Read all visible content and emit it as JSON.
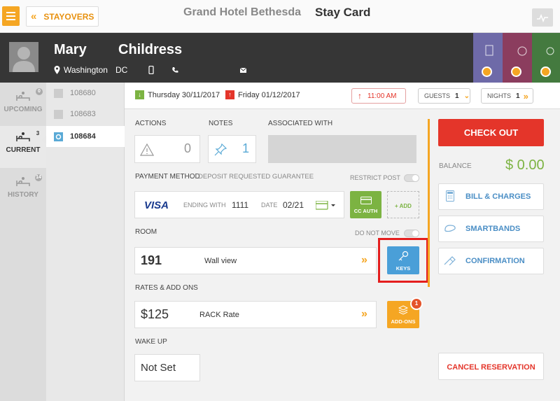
{
  "topbar": {
    "stayovers_label": "STAYOVERS",
    "hotel_name": "Grand Hotel Bethesda",
    "page_title": "Stay Card"
  },
  "guest": {
    "first_name": "Mary",
    "last_name": "Childress",
    "city": "Washington",
    "state": "DC"
  },
  "nav": {
    "upcoming": {
      "label": "UPCOMING",
      "count": "0"
    },
    "current": {
      "label": "CURRENT",
      "count": "3"
    },
    "history": {
      "label": "HISTORY",
      "count": "14"
    }
  },
  "rooms": [
    "108680",
    "108683",
    "108684"
  ],
  "dates": {
    "arrival": "Thursday 30/11/2017",
    "departure": "Friday 01/12/2017",
    "time": "11:00 AM",
    "guests_label": "GUESTS",
    "guests_count": "1",
    "nights_label": "NIGHTS",
    "nights_count": "1"
  },
  "actions": {
    "label": "ACTIONS",
    "count": "0"
  },
  "notes": {
    "label": "NOTES",
    "count": "1"
  },
  "associated": {
    "label": "ASSOCIATED WITH"
  },
  "payment": {
    "label": "PAYMENT METHOD",
    "sublabel": "DEPOSIT REQUESTED GUARANTEE",
    "restrict_label": "RESTRICT POST",
    "card_brand": "VISA",
    "ending_label": "ENDING WITH",
    "ending_value": "1111",
    "date_label": "DATE",
    "date_value": "02/21",
    "cc_auth_label": "CC AUTH",
    "add_label": "+ ADD"
  },
  "room": {
    "label": "ROOM",
    "do_not_move_label": "DO NOT MOVE",
    "number": "191",
    "description": "Wall view",
    "keys_label": "KEYS"
  },
  "rates": {
    "label": "RATES & ADD ONS",
    "amount": "$125",
    "rate_name": "RACK Rate",
    "addons_label": "ADD-ONS",
    "addons_count": "1"
  },
  "wakeup": {
    "label": "WAKE UP",
    "value": "Not Set"
  },
  "sidebar": {
    "checkout_label": "CHECK OUT",
    "balance_label": "BALANCE",
    "balance_value": "$ 0.00",
    "bill_label": "BILL & CHARGES",
    "smartbands_label": "SMARTBANDS",
    "confirmation_label": "CONFIRMATION",
    "cancel_label": "CANCEL RESERVATION"
  },
  "colors": {
    "accent_orange": "#f5a623",
    "checkout_red": "#e4352a",
    "balance_green": "#7cb342",
    "keys_blue": "#4a9fd8",
    "highlight_red": "#e41e1e"
  }
}
